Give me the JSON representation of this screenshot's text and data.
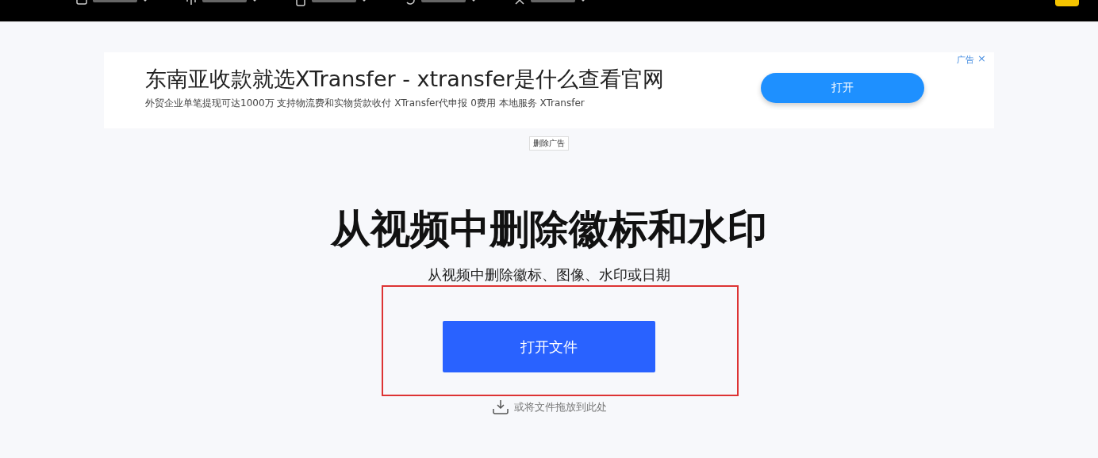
{
  "nav": {
    "items": [
      {
        "kind": "video"
      },
      {
        "kind": "audio"
      },
      {
        "kind": "pdf"
      },
      {
        "kind": "converter"
      },
      {
        "kind": "tools"
      }
    ]
  },
  "ad": {
    "label": "广告",
    "close": "×",
    "title": "东南亚收款就选XTransfer - xtransfer是什么查看官网",
    "description": "外贸企业单笔提现可达1000万 支持物流费和实物货款收付 XTransfer代申报 0费用 本地服务 XTransfer",
    "button": "打开",
    "remove": "删除广告"
  },
  "main": {
    "title": "从视频中删除徽标和水印",
    "subtitle": "从视频中删除徽标、图像、水印或日期",
    "open_button": "打开文件",
    "drop_hint": "或将文件拖放到此处",
    "highlighted": true
  }
}
